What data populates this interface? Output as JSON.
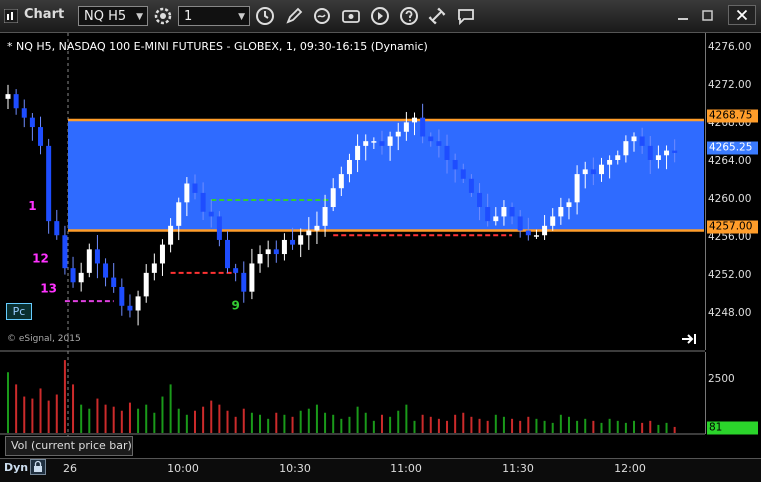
{
  "window": {
    "title": "Chart",
    "symbol_value": "NQ H5",
    "interval_value": "1"
  },
  "toolbar_icons": [
    "clock-icon",
    "refresh-icon",
    "pencil-icon",
    "swirl-icon",
    "screenshot-icon",
    "play-icon",
    "help-icon",
    "link-icon",
    "chat-icon"
  ],
  "chart": {
    "title": "* NQ H5, NASDAQ 100 E-MINI FUTURES - GLOBEX, 1, 09:30-16:15 (Dynamic)",
    "credit": "© eSignal, 2015",
    "pc_button": "Pc",
    "volume_label": "Vol (current price bar)",
    "dyn_label": "Dyn",
    "colors": {
      "up": "#ffffff",
      "down": "#1e4dff",
      "zone": "#2f6bff",
      "zone_border": "#ff9d2a",
      "vol_up": "#1a9a1a",
      "vol_down": "#cc2b2b"
    }
  },
  "chart_data": {
    "type": "candlestick",
    "price_axis": {
      "ticks": [
        "4276.00",
        "4272.00",
        "4268.00",
        "4264.00",
        "4260.00",
        "4256.00",
        "4252.00",
        "4248.00"
      ],
      "ylim": [
        4244.3,
        4278.0
      ]
    },
    "volume_axis": {
      "ticks": [
        "2500"
      ],
      "last_value": "81"
    },
    "time_axis": {
      "ticks": [
        "26",
        "10:00",
        "10:30",
        "11:00",
        "11:30",
        "12:00"
      ]
    },
    "price_labels": {
      "zone_top": "4268.75",
      "last": "4265.25",
      "zone_bottom": "4257.00"
    },
    "zone": {
      "high": 4268.75,
      "low": 4257.0
    },
    "levels": [
      {
        "price": 4249.5,
        "color": "#e040e0",
        "from_bar": 7,
        "to_bar": 13
      },
      {
        "price": 4252.5,
        "color": "#ff3333",
        "from_bar": 20,
        "to_bar": 28
      },
      {
        "price": 4260.25,
        "color": "#33cc33",
        "from_bar": 25,
        "to_bar": 40
      },
      {
        "price": 4256.5,
        "color": "#ff3333",
        "from_bar": 40,
        "to_bar": 62
      }
    ],
    "annotations": [
      {
        "text": "1",
        "bar": 3,
        "price": 4259.2,
        "color": "#ff33ff"
      },
      {
        "text": "12",
        "bar": 4,
        "price": 4253.6,
        "color": "#ff33ff"
      },
      {
        "text": "13",
        "bar": 5,
        "price": 4250.4,
        "color": "#ff33ff"
      },
      {
        "text": "9",
        "bar": 28,
        "price": 4248.6,
        "color": "#33cc33"
      }
    ],
    "closes": [
      4271.5,
      4270.0,
      4269.0,
      4268.0,
      4266.0,
      4258.0,
      4256.5,
      4253.0,
      4251.5,
      4252.5,
      4255.0,
      4253.5,
      4252.0,
      4251.0,
      4249.0,
      4248.5,
      4250.0,
      4252.5,
      4253.5,
      4255.5,
      4257.5,
      4260.0,
      4262.0,
      4261.0,
      4259.0,
      4258.5,
      4256.0,
      4253.0,
      4252.5,
      4250.5,
      4253.5,
      4254.5,
      4255.0,
      4254.5,
      4256.0,
      4255.5,
      4256.5,
      4257.0,
      4257.5,
      4259.5,
      4261.5,
      4263.0,
      4264.5,
      4266.0,
      4266.5,
      4266.5,
      4266.0,
      4267.0,
      4267.5,
      4268.5,
      4269.0,
      4267.0,
      4266.5,
      4266.0,
      4264.5,
      4263.5,
      4262.5,
      4261.0,
      4259.5,
      4258.0,
      4258.5,
      4259.5,
      4258.5,
      4257.0,
      4256.5,
      4256.5,
      4257.5,
      4258.5,
      4259.5,
      4260.0,
      4263.0,
      4263.5,
      4263.0,
      4264.0,
      4264.5,
      4265.0,
      4266.5,
      4267.0,
      4266.0,
      4264.5,
      4265.0,
      4265.5,
      4265.25
    ],
    "volume": [
      150,
      120,
      90,
      85,
      110,
      80,
      95,
      180,
      120,
      70,
      60,
      85,
      70,
      65,
      55,
      75,
      60,
      70,
      50,
      90,
      120,
      60,
      45,
      55,
      65,
      80,
      70,
      55,
      40,
      60,
      50,
      45,
      35,
      50,
      45,
      40,
      55,
      60,
      70,
      50,
      45,
      35,
      40,
      65,
      50,
      30,
      45,
      40,
      55,
      70,
      30,
      45,
      40,
      35,
      30,
      45,
      50,
      40,
      35,
      30,
      45,
      40,
      35,
      30,
      40,
      35,
      30,
      25,
      45,
      40,
      30,
      35,
      30,
      25,
      35,
      30,
      25,
      30,
      25,
      30,
      20,
      25,
      15
    ]
  }
}
